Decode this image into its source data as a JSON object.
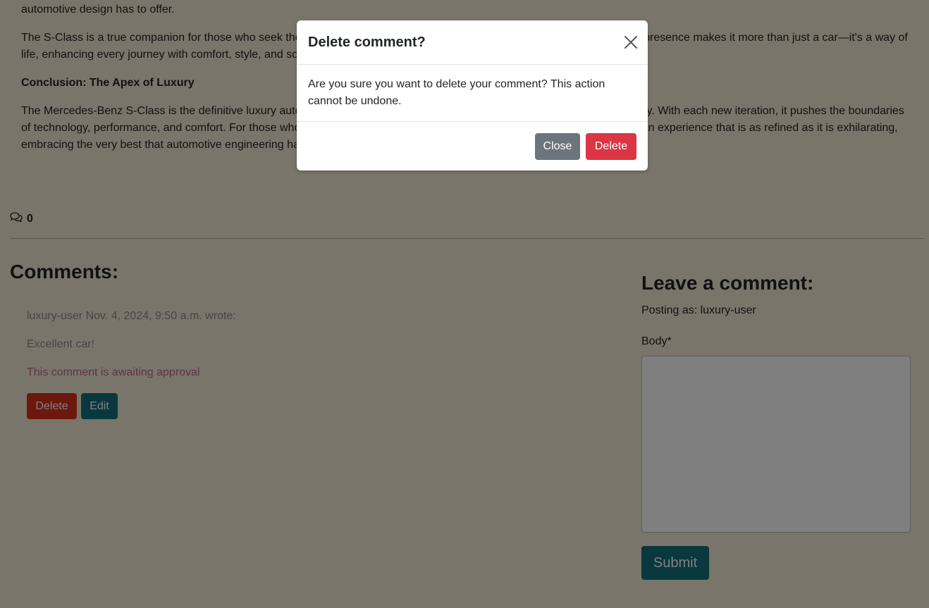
{
  "article": {
    "lead_fragment": "automotive design has to offer.",
    "paragraph_1": "The S-Class is a true companion for those who seek the finest things in life. It is a symbol of success and refinement, and its presence makes it more than just a car—it's a way of life, enhancing every journey with comfort, style, and sophistication.",
    "conclusion_heading": "Conclusion: The Apex of Luxury",
    "paragraph_2": "The Mercedes-Benz S-Class is the definitive luxury automobile, a vehicle that has consistently set the standard for the industry. With each new iteration, it pushes the boundaries of technology, performance, and comfort. For those who demand excellence in every aspect of their lives, the S-Class offers an experience that is as refined as it is exhilarating, embracing the very best that automotive engineering has to offer."
  },
  "comment_counter": {
    "icon": "comments-icon",
    "count": "0"
  },
  "comments": {
    "title": "Comments:",
    "items": [
      {
        "meta": "luxury-user Nov. 4, 2024, 9:50 a.m. wrote:",
        "body": "Excellent car!",
        "status": "This comment is awaiting approval",
        "delete_label": "Delete",
        "edit_label": "Edit"
      }
    ]
  },
  "leave_comment": {
    "title": "Leave a comment:",
    "posting_as": "Posting as: luxury-user",
    "body_label": "Body*",
    "submit_label": "Submit"
  },
  "modal": {
    "title": "Delete comment?",
    "body": "Are you sure you want to delete your comment? This action cannot be undone.",
    "close_label": "Close",
    "delete_label": "Delete"
  }
}
